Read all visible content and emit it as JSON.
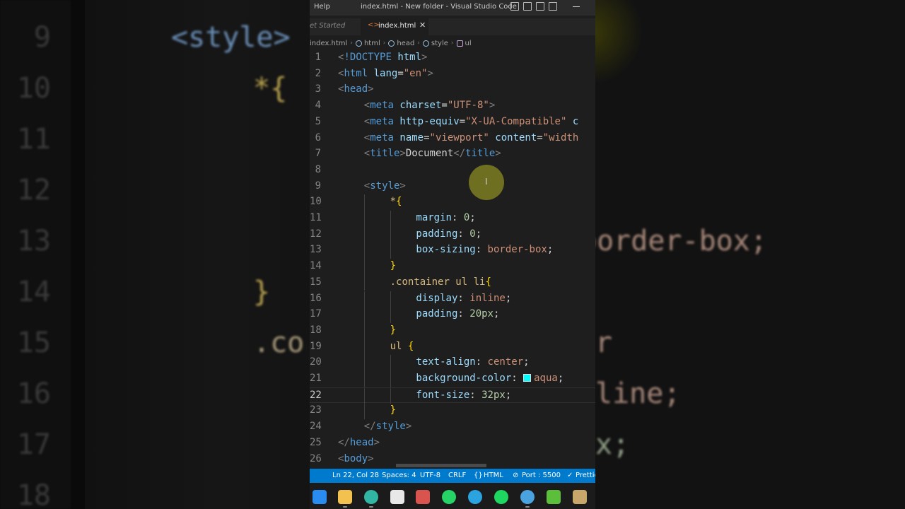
{
  "titlebar": {
    "menu": "Help",
    "title": "index.html - New folder - Visual Studio Code"
  },
  "tabs": {
    "inactive_label": "et Started",
    "active_label": "index.html",
    "close_glyph": "✕"
  },
  "breadcrumb": {
    "items": [
      "index.html",
      "html",
      "head",
      "style",
      "ul"
    ]
  },
  "editor": {
    "current_line": 22,
    "lines": [
      {
        "n": "1",
        "indent": 0,
        "tokens": [
          [
            "t-br",
            "<"
          ],
          [
            "t-tag",
            "!DOCTYPE"
          ],
          [
            "t-txt",
            " "
          ],
          [
            "t-attr",
            "html"
          ],
          [
            "t-br",
            ">"
          ]
        ]
      },
      {
        "n": "2",
        "indent": 0,
        "tokens": [
          [
            "t-br",
            "<"
          ],
          [
            "t-tag",
            "html"
          ],
          [
            "t-txt",
            " "
          ],
          [
            "t-attr",
            "lang"
          ],
          [
            "t-txt",
            "="
          ],
          [
            "t-str",
            "\"en\""
          ],
          [
            "t-br",
            ">"
          ]
        ]
      },
      {
        "n": "3",
        "indent": 0,
        "tokens": [
          [
            "t-br",
            "<"
          ],
          [
            "t-tag",
            "head"
          ],
          [
            "t-br",
            ">"
          ]
        ]
      },
      {
        "n": "4",
        "indent": 1,
        "tokens": [
          [
            "t-br",
            "<"
          ],
          [
            "t-tag",
            "meta"
          ],
          [
            "t-txt",
            " "
          ],
          [
            "t-attr",
            "charset"
          ],
          [
            "t-txt",
            "="
          ],
          [
            "t-str",
            "\"UTF-8\""
          ],
          [
            "t-br",
            ">"
          ]
        ]
      },
      {
        "n": "5",
        "indent": 1,
        "tokens": [
          [
            "t-br",
            "<"
          ],
          [
            "t-tag",
            "meta"
          ],
          [
            "t-txt",
            " "
          ],
          [
            "t-attr",
            "http-equiv"
          ],
          [
            "t-txt",
            "="
          ],
          [
            "t-str",
            "\"X-UA-Compatible\""
          ],
          [
            "t-txt",
            " "
          ],
          [
            "t-attr",
            "c"
          ]
        ]
      },
      {
        "n": "6",
        "indent": 1,
        "tokens": [
          [
            "t-br",
            "<"
          ],
          [
            "t-tag",
            "meta"
          ],
          [
            "t-txt",
            " "
          ],
          [
            "t-attr",
            "name"
          ],
          [
            "t-txt",
            "="
          ],
          [
            "t-str",
            "\"viewport\""
          ],
          [
            "t-txt",
            " "
          ],
          [
            "t-attr",
            "content"
          ],
          [
            "t-txt",
            "="
          ],
          [
            "t-str",
            "\"width"
          ]
        ]
      },
      {
        "n": "7",
        "indent": 1,
        "tokens": [
          [
            "t-br",
            "<"
          ],
          [
            "t-tag",
            "title"
          ],
          [
            "t-br",
            ">"
          ],
          [
            "t-txt",
            "Document"
          ],
          [
            "t-br",
            "</"
          ],
          [
            "t-tag",
            "title"
          ],
          [
            "t-br",
            ">"
          ]
        ]
      },
      {
        "n": "8",
        "indent": 0,
        "tokens": []
      },
      {
        "n": "9",
        "indent": 1,
        "tokens": [
          [
            "t-br",
            "<"
          ],
          [
            "t-tag",
            "style"
          ],
          [
            "t-br",
            ">"
          ]
        ]
      },
      {
        "n": "10",
        "indent": 2,
        "tokens": [
          [
            "t-sel",
            "*"
          ],
          [
            "t-brace",
            "{"
          ]
        ]
      },
      {
        "n": "11",
        "indent": 3,
        "tokens": [
          [
            "t-prop",
            "margin"
          ],
          [
            "t-txt",
            ": "
          ],
          [
            "t-num",
            "0"
          ],
          [
            "t-txt",
            ";"
          ]
        ]
      },
      {
        "n": "12",
        "indent": 3,
        "tokens": [
          [
            "t-prop",
            "padding"
          ],
          [
            "t-txt",
            ": "
          ],
          [
            "t-num",
            "0"
          ],
          [
            "t-txt",
            ";"
          ]
        ]
      },
      {
        "n": "13",
        "indent": 3,
        "tokens": [
          [
            "t-prop",
            "box-sizing"
          ],
          [
            "t-txt",
            ": "
          ],
          [
            "t-val",
            "border-box"
          ],
          [
            "t-txt",
            ";"
          ]
        ]
      },
      {
        "n": "14",
        "indent": 2,
        "tokens": [
          [
            "t-brace",
            "}"
          ]
        ]
      },
      {
        "n": "15",
        "indent": 2,
        "tokens": [
          [
            "t-sel",
            ".container ul li"
          ],
          [
            "t-brace",
            "{"
          ]
        ]
      },
      {
        "n": "16",
        "indent": 3,
        "tokens": [
          [
            "t-prop",
            "display"
          ],
          [
            "t-txt",
            ": "
          ],
          [
            "t-val",
            "inline"
          ],
          [
            "t-txt",
            ";"
          ]
        ]
      },
      {
        "n": "17",
        "indent": 3,
        "tokens": [
          [
            "t-prop",
            "padding"
          ],
          [
            "t-txt",
            ": "
          ],
          [
            "t-num",
            "20px"
          ],
          [
            "t-txt",
            ";"
          ]
        ]
      },
      {
        "n": "18",
        "indent": 2,
        "tokens": [
          [
            "t-brace",
            "}"
          ]
        ]
      },
      {
        "n": "19",
        "indent": 2,
        "tokens": [
          [
            "t-sel",
            "ul"
          ],
          [
            "t-txt",
            " "
          ],
          [
            "t-brace",
            "{"
          ]
        ]
      },
      {
        "n": "20",
        "indent": 3,
        "tokens": [
          [
            "t-prop",
            "text-align"
          ],
          [
            "t-txt",
            ": "
          ],
          [
            "t-val",
            "center"
          ],
          [
            "t-txt",
            ";"
          ]
        ]
      },
      {
        "n": "21",
        "indent": 3,
        "tokens": [
          [
            "t-prop",
            "background-color"
          ],
          [
            "t-txt",
            ": "
          ],
          [
            "swatch",
            "#00ffff"
          ],
          [
            "t-val",
            "aqua"
          ],
          [
            "t-txt",
            ";"
          ]
        ]
      },
      {
        "n": "22",
        "indent": 3,
        "tokens": [
          [
            "t-prop",
            "font-size"
          ],
          [
            "t-txt",
            ": "
          ],
          [
            "t-num",
            "32px"
          ],
          [
            "t-txt",
            ";"
          ]
        ]
      },
      {
        "n": "23",
        "indent": 2,
        "tokens": [
          [
            "t-brace",
            "}"
          ]
        ]
      },
      {
        "n": "24",
        "indent": 1,
        "tokens": [
          [
            "t-br",
            "</"
          ],
          [
            "t-tag",
            "style"
          ],
          [
            "t-br",
            ">"
          ]
        ]
      },
      {
        "n": "25",
        "indent": 0,
        "tokens": [
          [
            "t-br",
            "</"
          ],
          [
            "t-tag",
            "head"
          ],
          [
            "t-br",
            ">"
          ]
        ]
      },
      {
        "n": "26",
        "indent": 0,
        "tokens": [
          [
            "t-br",
            "<"
          ],
          [
            "t-tag",
            "body"
          ],
          [
            "t-br",
            ">"
          ]
        ]
      }
    ]
  },
  "statusbar": {
    "position": "Ln 22, Col 28",
    "spaces": "Spaces: 4",
    "encoding": "UTF-8",
    "eol": "CRLF",
    "language": "HTML",
    "port": "Port : 5500",
    "prettier": "Prettie"
  },
  "backdrop": {
    "line_numbers": [
      "9",
      "10",
      "11",
      "12",
      "13",
      "14",
      "15",
      "16",
      "17",
      "18"
    ],
    "left_code": [
      "<style>",
      "*{",
      "}",
      ".co"
    ],
    "right_code": [
      "border-box;",
      "line;",
      "x;",
      "r"
    ]
  },
  "taskbar": {
    "apps": [
      {
        "name": "windows-start-icon",
        "color": "#2b8cf0"
      },
      {
        "name": "file-explorer-icon",
        "color": "#f2c14e"
      },
      {
        "name": "edge-browser-icon",
        "color": "#32b6a4"
      },
      {
        "name": "store-icon",
        "color": "#e8e8e8"
      },
      {
        "name": "editor-app-icon",
        "color": "#d9534f"
      },
      {
        "name": "whatsapp-icon",
        "color": "#25d366"
      },
      {
        "name": "telegram-icon",
        "color": "#2aa3df"
      },
      {
        "name": "spotify-icon",
        "color": "#1ed760"
      },
      {
        "name": "chrome-icon",
        "color": "#4aa3df"
      },
      {
        "name": "notepad-plus-icon",
        "color": "#5cbf3b"
      },
      {
        "name": "misc-app-icon",
        "color": "#c8a86a"
      }
    ]
  },
  "colors": {
    "statusbar": "#007acc",
    "editor_bg": "#1e1e1e",
    "cursor_highlight": "#d2d228"
  }
}
